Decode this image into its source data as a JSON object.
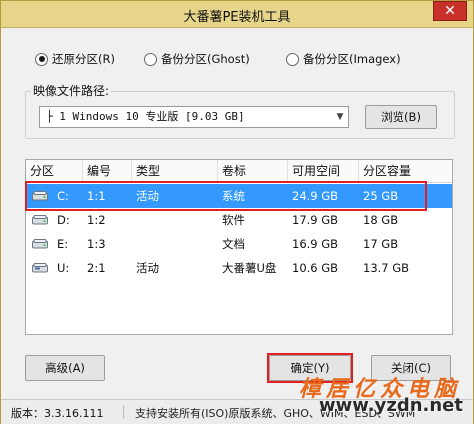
{
  "window": {
    "title": "大番薯PE装机工具",
    "close_label": "✕"
  },
  "modes": [
    {
      "label": "还原分区(R)",
      "selected": true
    },
    {
      "label": "备份分区(Ghost)",
      "selected": false
    },
    {
      "label": "备份分区(Imagex)",
      "selected": false
    }
  ],
  "image_path": {
    "group_label": "映像文件路径:",
    "selected_value": "├ 1 Windows 10 专业版 [9.03 GB]",
    "browse_label": "浏览(B)"
  },
  "partition_table": {
    "columns": [
      "分区",
      "编号",
      "类型",
      "卷标",
      "可用空间",
      "分区容量"
    ],
    "rows": [
      {
        "drive": "C:",
        "number": "1:1",
        "type": "活动",
        "label": "系统",
        "free": "24.9 GB",
        "size": "25 GB",
        "selected": true,
        "icon": "hard-drive-icon"
      },
      {
        "drive": "D:",
        "number": "1:2",
        "type": "",
        "label": "软件",
        "free": "17.9 GB",
        "size": "18 GB",
        "selected": false,
        "icon": "hard-drive-icon"
      },
      {
        "drive": "E:",
        "number": "1:3",
        "type": "",
        "label": "文档",
        "free": "16.9 GB",
        "size": "17 GB",
        "selected": false,
        "icon": "hard-drive-icon"
      },
      {
        "drive": "U:",
        "number": "2:1",
        "type": "活动",
        "label": "大番薯U盘",
        "free": "10.6 GB",
        "size": "13.7 GB",
        "selected": false,
        "icon": "usb-drive-icon"
      }
    ]
  },
  "buttons": {
    "advanced": "高级(A)",
    "confirm": "确定(Y)",
    "close": "关闭(C)"
  },
  "status": {
    "version": "版本：3.3.16.111",
    "info": "支持安装所有(ISO)原版系统、GHO、WIM、ESD、SWM"
  },
  "watermark": {
    "text": "樟居亿众电脑",
    "url": "www.yzdn.net"
  },
  "colors": {
    "titlebar": "#e7d58a",
    "selection": "#3399ff",
    "highlight": "#e02020",
    "watermark": "#e86a1c"
  }
}
